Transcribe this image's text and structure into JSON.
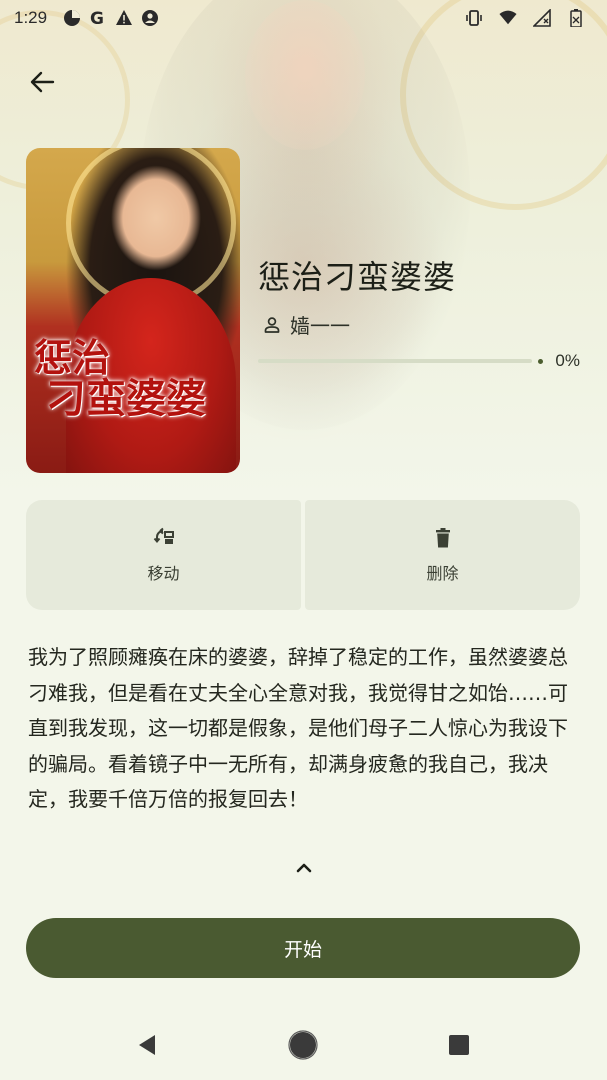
{
  "status_bar": {
    "time": "1:29",
    "left_icons": [
      "pie-chart-icon",
      "google-icon",
      "warning-icon",
      "account-circle-icon"
    ],
    "right_icons": [
      "vibrate-icon",
      "wifi-icon",
      "no-signal-icon",
      "battery-icon"
    ]
  },
  "header": {
    "back_icon": "arrow-left-icon"
  },
  "book": {
    "title": "惩治刁蛮婆婆",
    "author": "嫱一一",
    "author_icon": "person-icon",
    "progress_text": "0%",
    "progress_value": 0,
    "cover_title_line1": "惩治",
    "cover_title_line2": "刁蛮婆婆"
  },
  "actions": {
    "move_label": "移动",
    "move_icon": "swap-move-icon",
    "delete_label": "删除",
    "delete_icon": "trash-icon"
  },
  "description": {
    "text": "我为了照顾瘫痪在床的婆婆，辞掉了稳定的工作，虽然婆婆总刁难我，但是看在丈夫全心全意对我，我觉得甘之如饴……可直到我发现，这一切都是假象，是他们母子二人惊心为我设下的骗局。看着镜子中一无所有，却满身疲惫的我自己，我决定，我要千倍万倍的报复回去！",
    "collapse_icon": "chevron-up-icon"
  },
  "start_button": {
    "label": "开始"
  },
  "nav_bar": {
    "icons": [
      "back-triangle-icon",
      "home-circle-icon",
      "recents-square-icon"
    ]
  },
  "colors": {
    "background": "#f3f6ea",
    "primary": "#4a5a31",
    "action_bg": "#e6eadb"
  }
}
